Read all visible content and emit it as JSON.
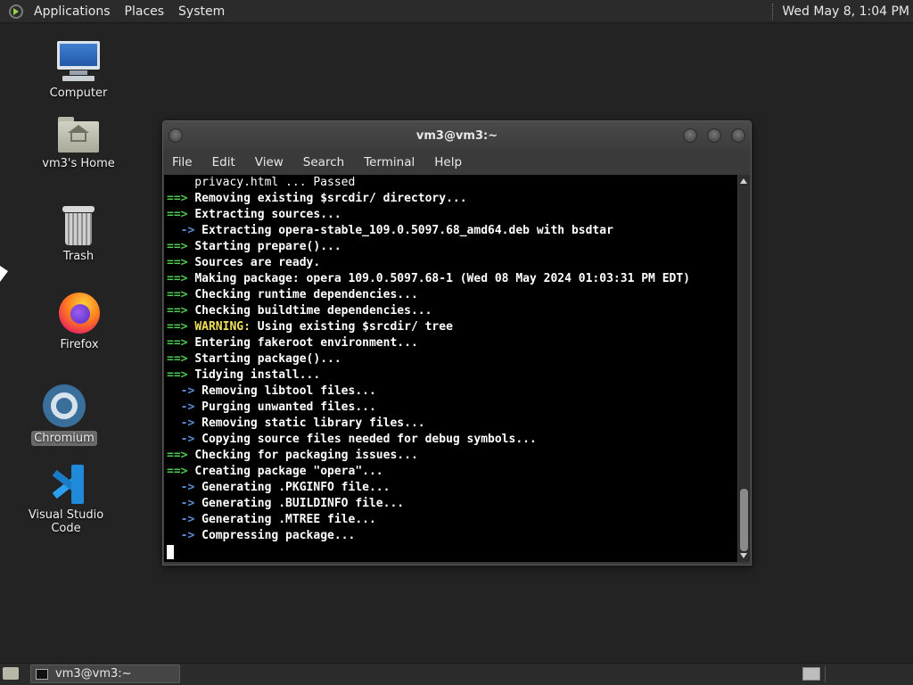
{
  "top_panel": {
    "menus": [
      "Applications",
      "Places",
      "System"
    ],
    "clock": "Wed May  8,  1:04 PM"
  },
  "desktop": {
    "icons": [
      {
        "label": "Computer",
        "icon": "computer-icon"
      },
      {
        "label": "vm3's Home",
        "icon": "home-folder-icon"
      },
      {
        "label": "Trash",
        "icon": "trash-icon"
      },
      {
        "label": "Firefox",
        "icon": "firefox-icon"
      },
      {
        "label": "Chromium",
        "icon": "chromium-icon",
        "selected": true
      },
      {
        "label": "Visual Studio Code",
        "icon": "vscode-icon"
      }
    ]
  },
  "terminal": {
    "title": "vm3@vm3:~",
    "menu": [
      "File",
      "Edit",
      "View",
      "Search",
      "Terminal",
      "Help"
    ],
    "lines": [
      {
        "prefix": "",
        "text": "    privacy.html ... Passed",
        "style": "plain"
      },
      {
        "prefix": "==> ",
        "text": "Removing existing $srcdir/ directory...",
        "style": "arrow"
      },
      {
        "prefix": "==> ",
        "text": "Extracting sources...",
        "style": "arrow"
      },
      {
        "prefix": "  -> ",
        "text": "Extracting opera-stable_109.0.5097.68_amd64.deb with bsdtar",
        "style": "subarrow"
      },
      {
        "prefix": "==> ",
        "text": "Starting prepare()...",
        "style": "arrow"
      },
      {
        "prefix": "==> ",
        "text": "Sources are ready.",
        "style": "arrow"
      },
      {
        "prefix": "==> ",
        "text": "Making package: opera 109.0.5097.68-1 (Wed 08 May 2024 01:03:31 PM EDT)",
        "style": "arrow"
      },
      {
        "prefix": "==> ",
        "text": "Checking runtime dependencies...",
        "style": "arrow"
      },
      {
        "prefix": "==> ",
        "text": "Checking buildtime dependencies...",
        "style": "arrow"
      },
      {
        "prefix": "==> ",
        "warn": "WARNING:",
        "text": " Using existing $srcdir/ tree",
        "style": "warn"
      },
      {
        "prefix": "==> ",
        "text": "Entering fakeroot environment...",
        "style": "arrow"
      },
      {
        "prefix": "==> ",
        "text": "Starting package()...",
        "style": "arrow"
      },
      {
        "prefix": "==> ",
        "text": "Tidying install...",
        "style": "arrow"
      },
      {
        "prefix": "  -> ",
        "text": "Removing libtool files...",
        "style": "subarrow"
      },
      {
        "prefix": "  -> ",
        "text": "Purging unwanted files...",
        "style": "subarrow"
      },
      {
        "prefix": "  -> ",
        "text": "Removing static library files...",
        "style": "subarrow"
      },
      {
        "prefix": "  -> ",
        "text": "Copying source files needed for debug symbols...",
        "style": "subarrow"
      },
      {
        "prefix": "==> ",
        "text": "Checking for packaging issues...",
        "style": "arrow"
      },
      {
        "prefix": "==> ",
        "text": "Creating package \"opera\"...",
        "style": "arrow"
      },
      {
        "prefix": "  -> ",
        "text": "Generating .PKGINFO file...",
        "style": "subarrow"
      },
      {
        "prefix": "  -> ",
        "text": "Generating .BUILDINFO file...",
        "style": "subarrow"
      },
      {
        "prefix": "  -> ",
        "text": "Generating .MTREE file...",
        "style": "subarrow"
      },
      {
        "prefix": "  -> ",
        "text": "Compressing package...",
        "style": "subarrow"
      }
    ]
  },
  "taskbar": {
    "tasks": [
      "vm3@vm3:~"
    ]
  },
  "colors": {
    "arrow": "#4ec94e",
    "subarrow": "#5a8dd8",
    "warning": "#f2e05a",
    "terminal_bg": "#000000"
  }
}
